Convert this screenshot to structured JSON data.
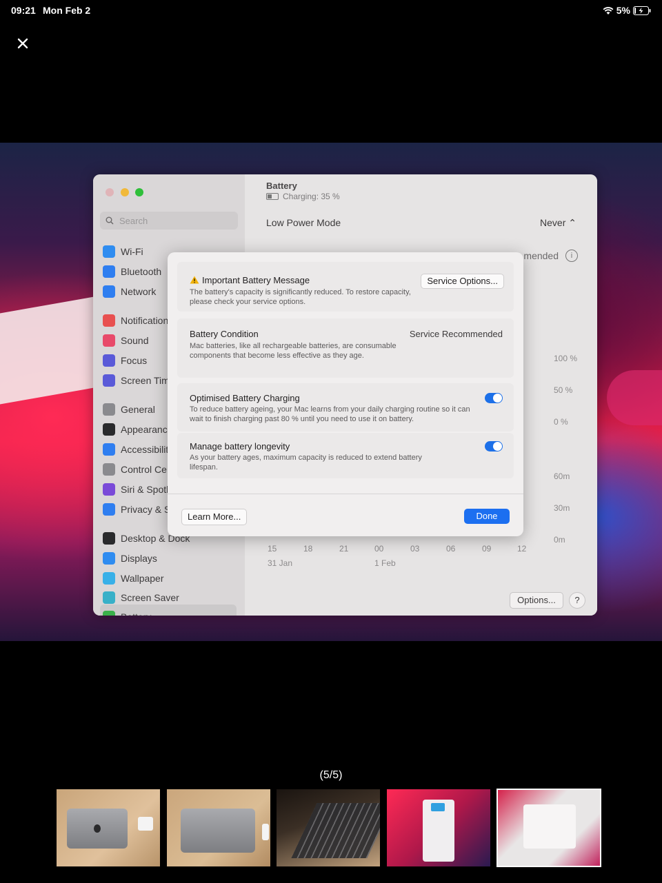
{
  "status_bar": {
    "time": "09:21",
    "date": "Mon Feb 2",
    "battery_percent": "5%"
  },
  "viewer": {
    "close_icon": "close-icon",
    "pager": "(5/5)",
    "thumbnail_count": 5,
    "selected_thumbnail": 5
  },
  "mac_window": {
    "sidebar": {
      "search_placeholder": "Search",
      "items": [
        {
          "label": "Wi-Fi",
          "color": "#2f8cf0"
        },
        {
          "label": "Bluetooth",
          "color": "#2f7ef0"
        },
        {
          "label": "Network",
          "color": "#2f7ef0"
        },
        {
          "label": "Notification",
          "color": "#e85050"
        },
        {
          "label": "Sound",
          "color": "#e84a6a"
        },
        {
          "label": "Focus",
          "color": "#5a5ad8"
        },
        {
          "label": "Screen Tim",
          "color": "#5a5ad8"
        },
        {
          "label": "General",
          "color": "#8a8a8e"
        },
        {
          "label": "Appearanc",
          "color": "#2a2a2c"
        },
        {
          "label": "Accessibilit",
          "color": "#2f7ef0"
        },
        {
          "label": "Control Ce",
          "color": "#8a8a8e"
        },
        {
          "label": "Siri & Spotl",
          "color": "#7a4ad8"
        },
        {
          "label": "Privacy & S",
          "color": "#2f7ef0"
        },
        {
          "label": "Desktop & Dock",
          "color": "#2a2a2c"
        },
        {
          "label": "Displays",
          "color": "#2f8cf0"
        },
        {
          "label": "Wallpaper",
          "color": "#38b0e8"
        },
        {
          "label": "Screen Saver",
          "color": "#38b0c8"
        },
        {
          "label": "Battery",
          "color": "#3ab04a"
        }
      ]
    },
    "content": {
      "title": "Battery",
      "subtitle": "Charging: 35 %",
      "low_power_mode_label": "Low Power Mode",
      "low_power_mode_value": "Never",
      "recommended_fragment": "mended",
      "chart": {
        "y_top_labels": [
          "100 %",
          "50 %",
          "0 %"
        ],
        "y_bottom_labels": [
          "60m",
          "30m",
          "0m"
        ],
        "x_labels": [
          "15",
          "18",
          "21",
          "00",
          "03",
          "06",
          "09",
          "12"
        ],
        "date_labels": [
          "31 Jan",
          "1 Feb"
        ]
      },
      "options_label": "Options...",
      "help_label": "?"
    },
    "dialog": {
      "message_title": "Important Battery Message",
      "message_text": "The battery's capacity is significantly reduced. To restore capacity, please check your service options.",
      "service_options_label": "Service Options...",
      "condition_title": "Battery Condition",
      "condition_value": "Service Recommended",
      "condition_text": "Mac batteries, like all rechargeable batteries, are consumable components that become less effective as they age.",
      "optimised_title": "Optimised Battery Charging",
      "optimised_text": "To reduce battery ageing, your Mac learns from your daily charging routine so it can wait to finish charging past 80 % until you need to use it on battery.",
      "optimised_on": true,
      "longevity_title": "Manage battery longevity",
      "longevity_text": "As your battery ages, maximum capacity is reduced to extend battery lifespan.",
      "longevity_on": true,
      "learn_more_label": "Learn More...",
      "done_label": "Done"
    }
  }
}
